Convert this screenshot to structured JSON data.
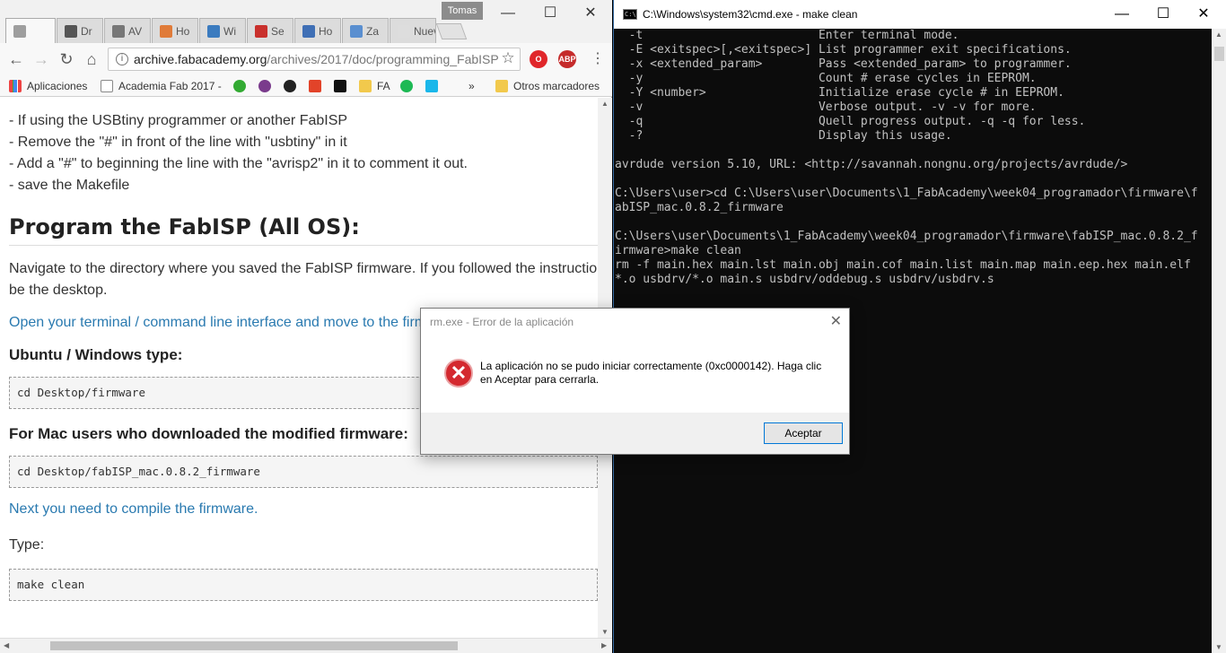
{
  "browser": {
    "profile_name": "Tomas",
    "tabs": [
      {
        "label": "",
        "color": "#9e9e9e"
      },
      {
        "label": "Dr",
        "color": "#555555"
      },
      {
        "label": "AV",
        "color": "#777777"
      },
      {
        "label": "Ho",
        "color": "#e07b39"
      },
      {
        "label": "Wi",
        "color": "#3b7bbf"
      },
      {
        "label": "Se",
        "color": "#c9302c"
      },
      {
        "label": "Ho",
        "color": "#3f6fb5"
      },
      {
        "label": "Za",
        "color": "#5a8fd0"
      },
      {
        "label": "Nueva",
        "color": "#dddddd"
      }
    ],
    "url_host": "archive.fabacademy.org",
    "url_path": "/archives/2017/doc/programming_FabISP",
    "bookmarks": {
      "apps": "Aplicaciones",
      "academia": "Academia Fab 2017 -",
      "fa": "FA",
      "more": "»",
      "other": "Otros marcadores"
    },
    "extensions": {
      "opera_color": "#e0262a",
      "abp_label": "ABP",
      "abp_color": "#c52b2b"
    }
  },
  "page": {
    "bullets": [
      "- If using the USBtiny programmer or another FabISP",
      "- Remove the \"#\" in front of the line with \"usbtiny\" in it",
      "- Add a \"#\" to beginning the line with the \"avrisp2\" in it to comment it out.",
      "- save the Makefile"
    ],
    "heading": "Program the FabISP (All OS):",
    "para1": "Navigate to the directory where you saved the FabISP firmware. If you followed the instructio",
    "para1_cont": "be the desktop.",
    "link1": "Open your terminal / command line interface and move to the firm",
    "sub1": "Ubuntu / Windows type:",
    "code1": "cd Desktop/firmware",
    "sub2": "For Mac users who downloaded the modified firmware:",
    "code2": "cd Desktop/fabISP_mac.0.8.2_firmware",
    "link2": "Next you need to compile the firmware.",
    "type_label": "Type:",
    "code3": "make clean"
  },
  "cmd": {
    "title": "C:\\Windows\\system32\\cmd.exe - make  clean",
    "lines": [
      "  -t                         Enter terminal mode.",
      "  -E <exitspec>[,<exitspec>] List programmer exit specifications.",
      "  -x <extended_param>        Pass <extended_param> to programmer.",
      "  -y                         Count # erase cycles in EEPROM.",
      "  -Y <number>                Initialize erase cycle # in EEPROM.",
      "  -v                         Verbose output. -v -v for more.",
      "  -q                         Quell progress output. -q -q for less.",
      "  -?                         Display this usage.",
      "",
      "avrdude version 5.10, URL: <http://savannah.nongnu.org/projects/avrdude/>",
      "",
      "C:\\Users\\user>cd C:\\Users\\user\\Documents\\1_FabAcademy\\week04_programador\\firmware\\f",
      "abISP_mac.0.8.2_firmware",
      "",
      "C:\\Users\\user\\Documents\\1_FabAcademy\\week04_programador\\firmware\\fabISP_mac.0.8.2_f",
      "irmware>make clean",
      "rm -f main.hex main.lst main.obj main.cof main.list main.map main.eep.hex main.elf",
      "*.o usbdrv/*.o main.s usbdrv/oddebug.s usbdrv/usbdrv.s"
    ]
  },
  "dialog": {
    "title": "rm.exe - Error de la aplicación",
    "message": "La aplicación no se pudo iniciar correctamente (0xc0000142). Haga clic en Aceptar para cerrarla.",
    "ok_label": "Aceptar"
  }
}
